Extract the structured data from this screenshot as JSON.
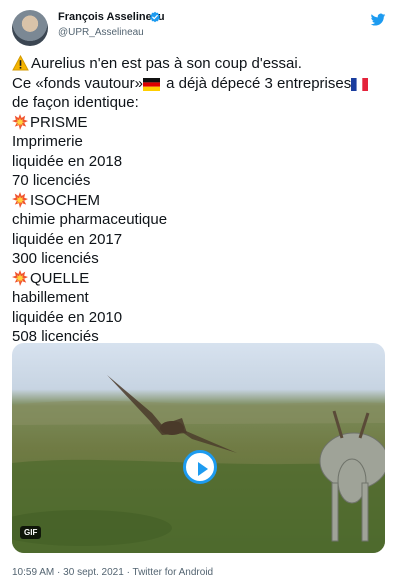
{
  "author": {
    "name": "François Asselineau",
    "handle": "@UPR_Asselineau"
  },
  "icons": {
    "verified": "verified-badge-icon",
    "platform": "twitter-bird-icon",
    "warning": "warning-emoji",
    "flags": [
      "germany-flag-emoji",
      "france-flag-emoji"
    ],
    "bullets": "explosion-emoji"
  },
  "tweet": {
    "intro_1": "Aurelius n'en est pas à son coup d'essai.",
    "intro_2_prefix": "Ce «fonds vautour»",
    "intro_2_suffix": " a déjà dépecé 3 entreprises",
    "intro_3": "de façon identique:",
    "companies": [
      {
        "name": "PRISME",
        "sector": "Imprimerie",
        "fate": "liquidée en 2018",
        "layoffs": "70 licenciés"
      },
      {
        "name": "ISOCHEM",
        "sector": "chimie pharmaceutique",
        "fate": "liquidée en 2017",
        "layoffs": "300 licenciés"
      },
      {
        "name": "QUELLE",
        "sector": "habillement",
        "fate": "liquidée en 2010",
        "layoffs": "508 licenciés"
      }
    ]
  },
  "media": {
    "badge": "GIF"
  },
  "footer": {
    "time": "10:59 AM",
    "date": "30 sept. 2021",
    "source": "Twitter for Android",
    "separator": "·"
  },
  "colors": {
    "accent": "#1d9bf0",
    "text": "#0f1419",
    "secondary": "#536471"
  }
}
